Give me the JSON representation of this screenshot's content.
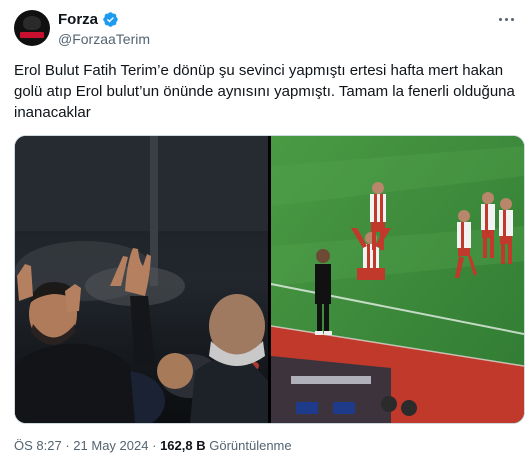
{
  "author": {
    "display_name": "Forza",
    "handle": "@ForzaaTerim",
    "verified": true,
    "avatar_icon": "forza-logo"
  },
  "tweet": {
    "text": "Erol Bulut Fatih Terim’e dönüp şu sevinci yapmıştı ertesi hafta mert hakan golü atıp Erol bulut’un önünde aynısını yapmıştı. Tamam la fenerli olduğuna inanacaklar"
  },
  "media": {
    "photos": [
      "photo-coach-celebration",
      "photo-player-celebration"
    ]
  },
  "meta": {
    "time": "ÖS 8:27",
    "separator": "·",
    "date": "21 May 2024",
    "views_count": "162,8 B",
    "views_label": "Görüntülenme"
  },
  "colors": {
    "verified_blue": "#1d9bf0",
    "text_primary": "#0f1419",
    "text_secondary": "#536471",
    "border": "#cfd9de"
  }
}
